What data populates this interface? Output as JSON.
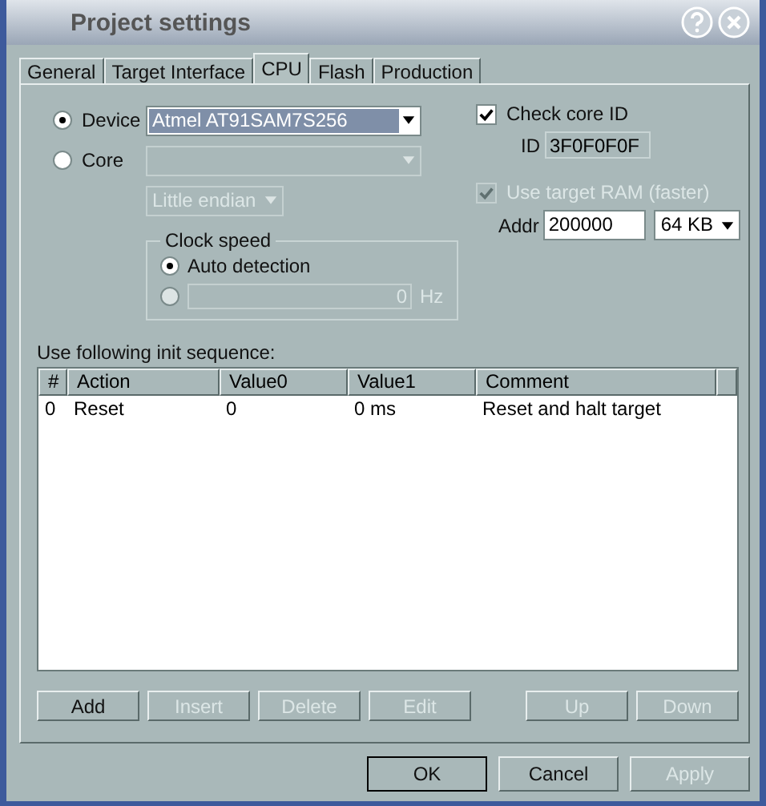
{
  "window": {
    "title": "Project settings"
  },
  "tabs": [
    {
      "label": "General",
      "selected": false
    },
    {
      "label": "Target Interface",
      "selected": false
    },
    {
      "label": "CPU",
      "selected": true
    },
    {
      "label": "Flash",
      "selected": false
    },
    {
      "label": "Production",
      "selected": false
    }
  ],
  "target": {
    "options": [
      {
        "label": "Device",
        "selected": true,
        "value": "Atmel AT91SAM7S256",
        "disabled": false
      },
      {
        "label": "Core",
        "selected": false,
        "disabled": true
      }
    ],
    "endian": {
      "value": "Little endian",
      "disabled": true
    }
  },
  "clock_speed": {
    "title": "Clock speed",
    "auto": {
      "label": "Auto detection",
      "selected": true
    },
    "manual": {
      "selected": false,
      "value": "0",
      "unit": "Hz",
      "disabled": true
    }
  },
  "check_core_id": {
    "label": "Check core ID",
    "checked": true,
    "id_label": "ID",
    "id_value": "3F0F0F0F"
  },
  "use_target_ram": {
    "label": "Use target RAM (faster)",
    "checked": true,
    "disabled": true,
    "addr_label": "Addr",
    "addr_value": "200000",
    "size": "64 KB"
  },
  "init_sequence": {
    "label": "Use following init sequence:",
    "columns": [
      "#",
      "Action",
      "Value0",
      "Value1",
      "Comment"
    ],
    "rows": [
      [
        "0",
        "Reset",
        "0",
        "0 ms",
        "Reset and halt target"
      ]
    ]
  },
  "list_buttons": [
    {
      "label": "Add",
      "disabled": false
    },
    {
      "label": "Insert",
      "disabled": true
    },
    {
      "label": "Delete",
      "disabled": true
    },
    {
      "label": "Edit",
      "disabled": true
    },
    {
      "label": "Up",
      "disabled": true
    },
    {
      "label": "Down",
      "disabled": true
    }
  ],
  "dialog_buttons": [
    {
      "label": "OK",
      "disabled": false,
      "default": true
    },
    {
      "label": "Cancel",
      "disabled": false,
      "default": false
    },
    {
      "label": "Apply",
      "disabled": true,
      "default": false
    }
  ]
}
